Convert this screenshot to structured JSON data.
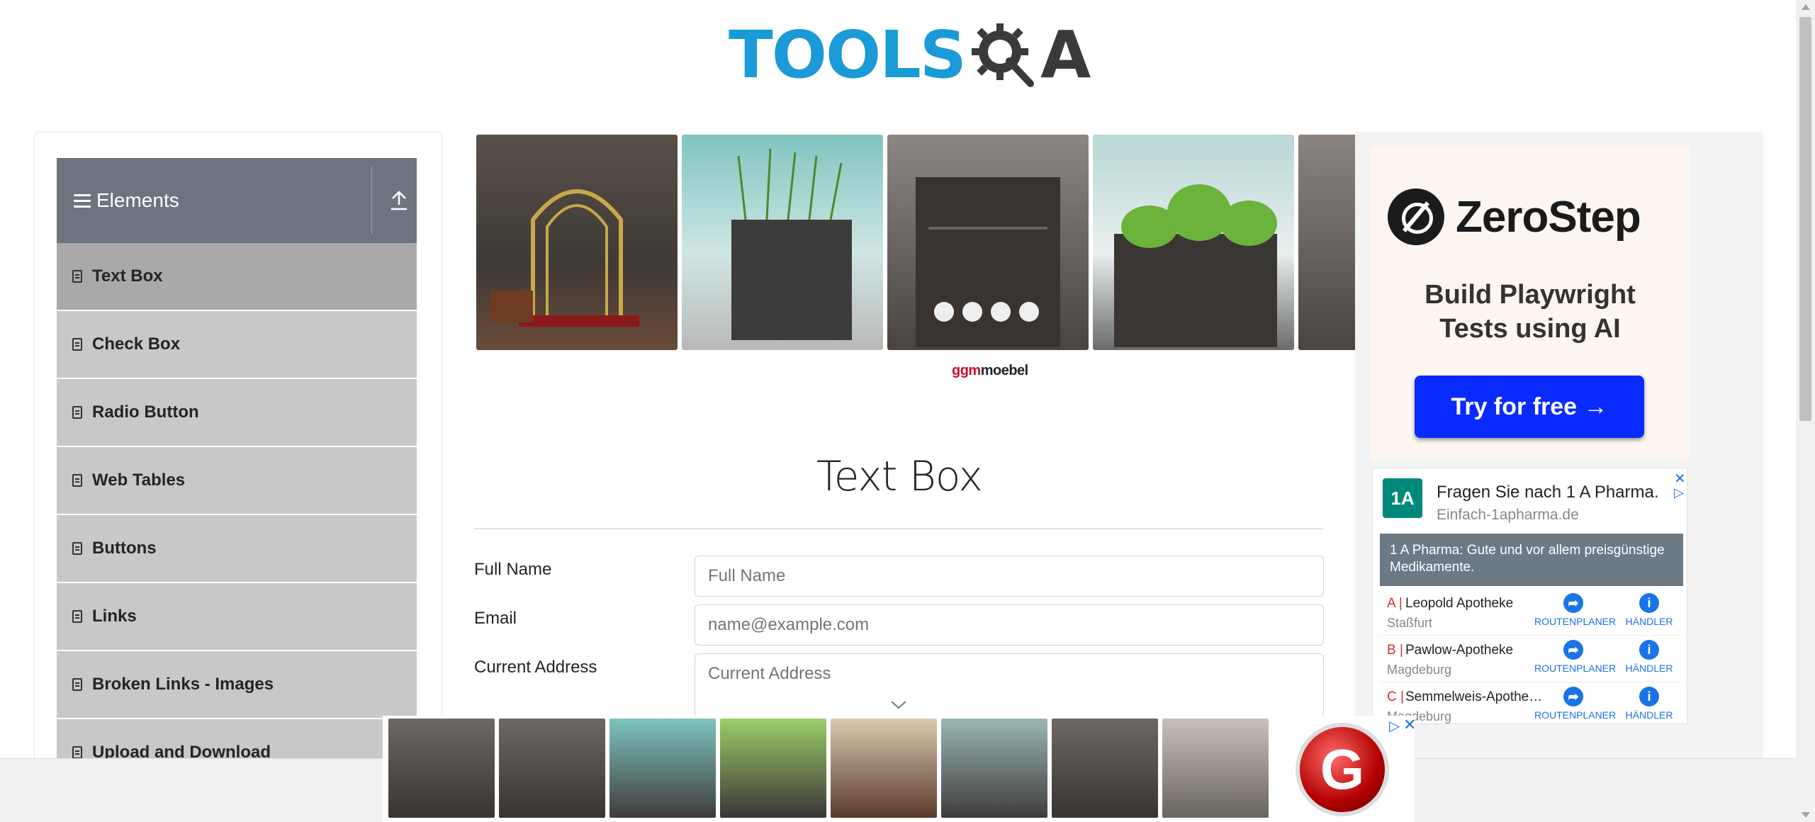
{
  "header": {
    "logo_tools": "TOOLS",
    "logo_qa": "A"
  },
  "sidebar": {
    "group_title": "Elements",
    "items": [
      {
        "label": "Text Box",
        "active": true
      },
      {
        "label": "Check Box"
      },
      {
        "label": "Radio Button"
      },
      {
        "label": "Web Tables"
      },
      {
        "label": "Buttons"
      },
      {
        "label": "Links"
      },
      {
        "label": "Broken Links - Images"
      },
      {
        "label": "Upload and Download"
      }
    ]
  },
  "top_ad": {
    "brand_a": "ggm",
    "brand_b": "moebel"
  },
  "main": {
    "title": "Text Box",
    "fields": {
      "full_name": {
        "label": "Full Name",
        "placeholder": "Full Name"
      },
      "email": {
        "label": "Email",
        "placeholder": "name@example.com"
      },
      "current_address": {
        "label": "Current Address",
        "placeholder": "Current Address"
      }
    }
  },
  "zerostep_ad": {
    "brand": "ZeroStep",
    "tagline_1": "Build Playwright",
    "tagline_2": "Tests using AI",
    "cta": "Try for free →"
  },
  "pharma_ad": {
    "logo": "1A",
    "title": "Fragen Sie nach 1 A Pharma.",
    "url": "Einfach-1apharma.de",
    "banner": "1 A Pharma: Gute und vor allem preisgünstige Medikamente.",
    "route_label": "ROUTENPLANER",
    "dealer_label": "HÄNDLER",
    "rows": [
      {
        "letter": "A |",
        "name": "Leopold Apotheke",
        "city": "Staßfurt"
      },
      {
        "letter": "B |",
        "name": "Pawlow-Apotheke",
        "city": "Magdeburg"
      },
      {
        "letter": "C |",
        "name": "Semmelweis-Apothe…",
        "city": "Magdeburg"
      }
    ]
  },
  "colors": {
    "accent": "#1a9ad6",
    "group_header": "#6c757d",
    "menu_bg": "#c8c8c8",
    "menu_active": "#a9a9a9",
    "cta": "#0a2bff"
  }
}
